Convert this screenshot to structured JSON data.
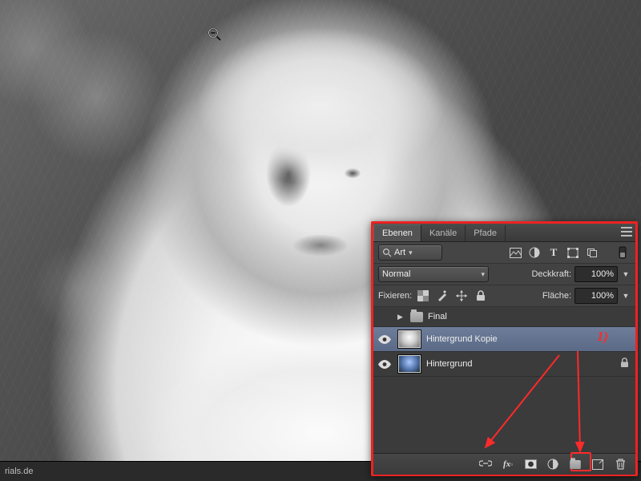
{
  "footer": {
    "text": "rials.de"
  },
  "cursor": {
    "name": "zoom-out"
  },
  "panel": {
    "tabs": {
      "layers": "Ebenen",
      "channels": "Kanäle",
      "paths": "Pfade",
      "active": "layers"
    },
    "filter": {
      "label": "Art"
    },
    "blend": {
      "mode": "Normal",
      "opacity_label": "Deckkraft:",
      "opacity": "100%"
    },
    "lock": {
      "label": "Fixieren:",
      "fill_label": "Fläche:",
      "fill": "100%"
    },
    "group": {
      "name": "Final"
    },
    "layers": [
      {
        "name": "Hintergrund Kopie",
        "selected": true,
        "locked": false,
        "annot": "1)"
      },
      {
        "name": "Hintergrund",
        "selected": false,
        "locked": true
      }
    ]
  },
  "icons": {
    "filter_row": [
      "image-icon",
      "adjustment-icon",
      "type-icon",
      "shape-icon",
      "smartobject-icon"
    ],
    "bottom": [
      "link-icon",
      "fx-icon",
      "mask-icon",
      "adjustment-layer-icon",
      "group-icon",
      "new-layer-icon",
      "trash-icon"
    ]
  }
}
